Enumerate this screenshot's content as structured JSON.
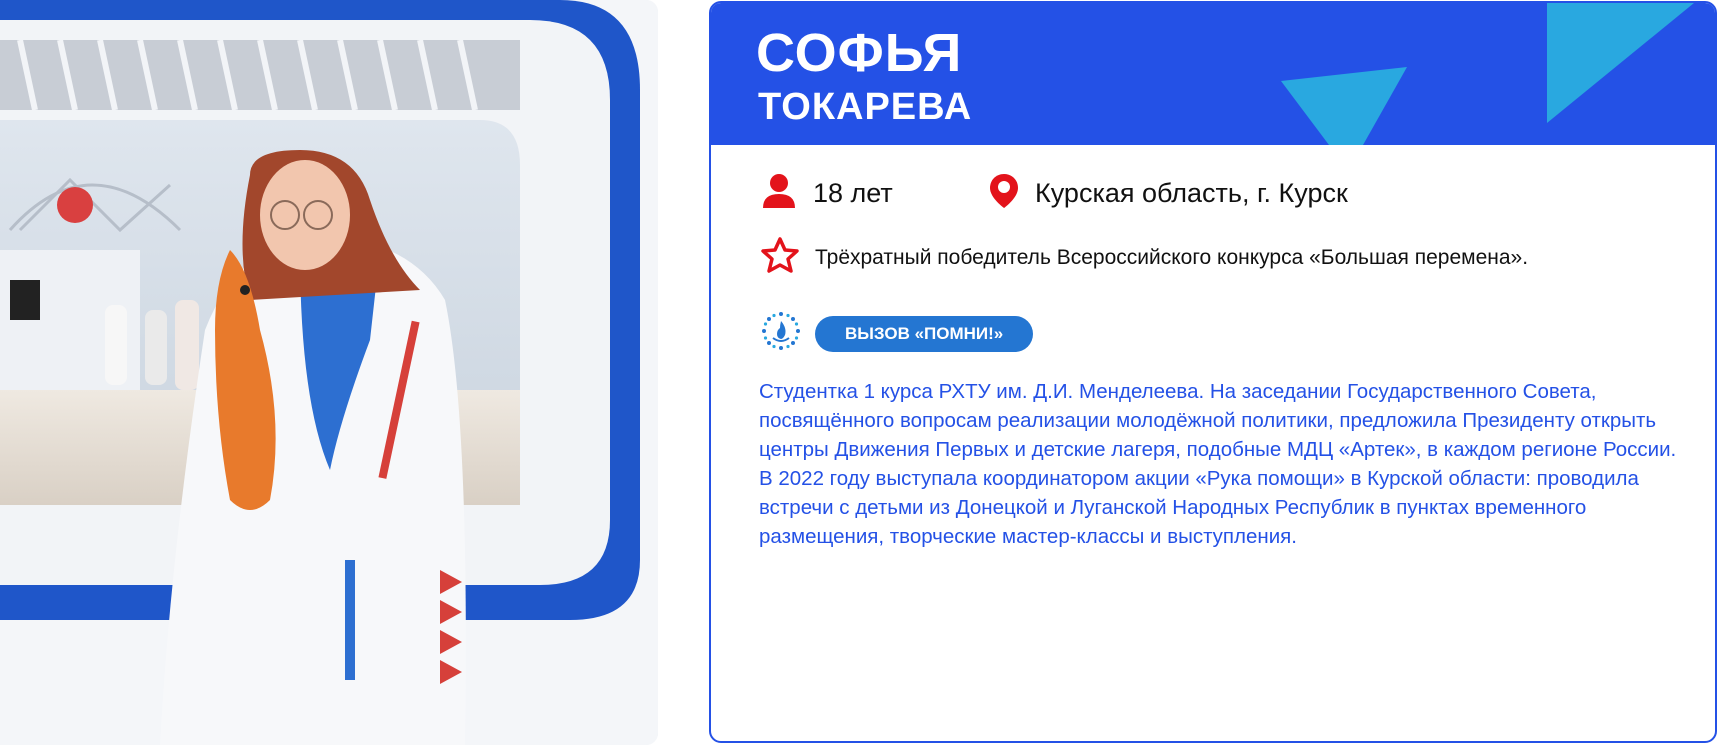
{
  "person": {
    "first_name": "СОФЬЯ",
    "last_name": "ТОКАРЕВА",
    "age": "18 лет",
    "location": "Курская область, г. Курск",
    "award": "Трёхратный победитель Всероссийского конкурса «Большая перемена».",
    "challenge_badge": "ВЫЗОВ «ПОМНИ!»",
    "bio": "Студентка 1 курса РХТУ им. Д.И. Менделеева. На заседании Государственного Совета, посвящённого вопросам реализации молодёжной политики, предложила Президенту открыть центры Движения Первых и детские лагеря, подобные МДЦ «Артек», в каждом регионе России. В 2022 году выступала координатором акции «Рука помощи» в Курской области: проводила встречи с детьми из Донецкой и Луганской Народных Республик в пунктах временного размещения, творческие мастер-классы и выступления."
  },
  "icons": {
    "age": "person-icon",
    "location": "map-pin-icon",
    "award": "star-icon",
    "challenge": "flame-emblem-icon"
  },
  "colors": {
    "brand_blue": "#2451e6",
    "accent_cyan": "#29a8e0",
    "badge_blue": "#2476d2",
    "icon_red": "#e3131b"
  }
}
